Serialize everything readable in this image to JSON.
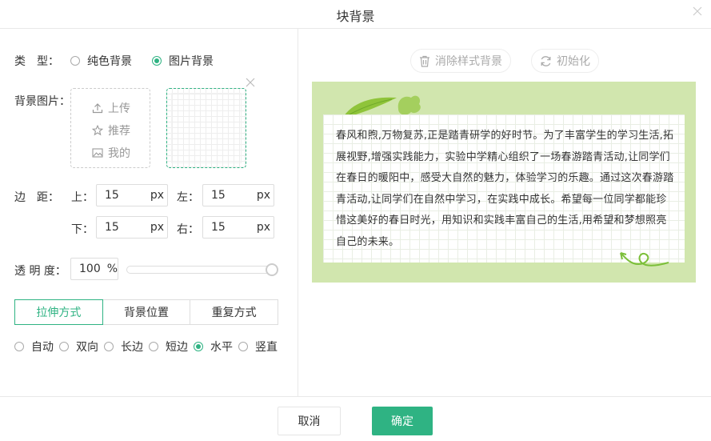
{
  "dialog": {
    "title": "块背景"
  },
  "type": {
    "label": "类　型：",
    "options": [
      "纯色背景",
      "图片背景"
    ],
    "selected": "图片背景"
  },
  "bg_image": {
    "label": "背景图片：",
    "upload": "上传",
    "recommend": "推荐",
    "mine": "我的"
  },
  "margin": {
    "label": "边　距：",
    "top_label": "上：",
    "top_value": "15",
    "left_label": "左：",
    "left_value": "15",
    "bottom_label": "下：",
    "bottom_value": "15",
    "right_label": "右：",
    "right_value": "15",
    "unit": "px"
  },
  "opacity": {
    "label": "透 明 度：",
    "value": "100",
    "unit": "%",
    "level": 1.0
  },
  "tabs": [
    "拉伸方式",
    "背景位置",
    "重复方式"
  ],
  "active_tab": "拉伸方式",
  "stretch": {
    "options": [
      "自动",
      "双向",
      "长边",
      "短边",
      "水平",
      "竖直"
    ],
    "selected": "水平"
  },
  "toolbar": {
    "clear_label": "消除样式背景",
    "reset_label": "初始化"
  },
  "preview": {
    "text": "春风和煦,万物复苏,正是踏青研学的好时节。为了丰富学生的学习生活,拓展视野,增强实践能力，实验中学精心组织了一场春游踏青活动,让同学们在春日的暖阳中，感受大自然的魅力，体验学习的乐趣。通过这次春游踏青活动,让同学们在自然中学习，在实践中成长。希望每一位同学都能珍惜这美好的春日时光，用知识和实践丰富自己的生活,用希望和梦想照亮自己的未来。"
  },
  "footer": {
    "cancel_label": "取消",
    "ok_label": "确定"
  },
  "colors": {
    "accent": "#2fb383",
    "preview_bg": "#d1e6ae"
  }
}
